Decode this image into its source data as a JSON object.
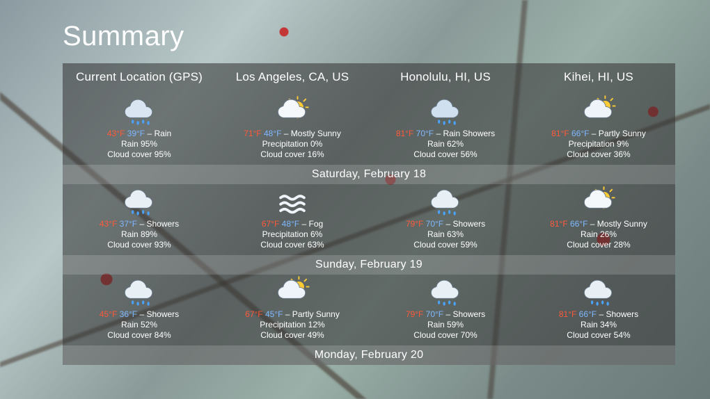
{
  "title": "Summary",
  "locations": [
    "Current Location (GPS)",
    "Los Angeles, CA, US",
    "Honolulu, HI, US",
    "Kihei, HI, US"
  ],
  "days": [
    {
      "label": "Saturday, February 18",
      "cells": [
        {
          "icon": "rain",
          "hi": "43°F",
          "lo": "39°F",
          "cond": "Rain",
          "precipLabel": "Rain 95%",
          "cloud": "Cloud cover 95%"
        },
        {
          "icon": "mostly-sunny",
          "hi": "71°F",
          "lo": "48°F",
          "cond": "Mostly Sunny",
          "precipLabel": "Precipitation 0%",
          "cloud": "Cloud cover 16%"
        },
        {
          "icon": "rain-showers",
          "hi": "81°F",
          "lo": "70°F",
          "cond": "Rain Showers",
          "precipLabel": "Rain 62%",
          "cloud": "Cloud cover 56%"
        },
        {
          "icon": "partly-sunny",
          "hi": "81°F",
          "lo": "66°F",
          "cond": "Partly Sunny",
          "precipLabel": "Precipitation 9%",
          "cloud": "Cloud cover 36%"
        }
      ]
    },
    {
      "label": "Sunday, February 19",
      "cells": [
        {
          "icon": "showers",
          "hi": "43°F",
          "lo": "37°F",
          "cond": "Showers",
          "precipLabel": "Rain 89%",
          "cloud": "Cloud cover 93%"
        },
        {
          "icon": "fog",
          "hi": "67°F",
          "lo": "48°F",
          "cond": "Fog",
          "precipLabel": "Precipitation 6%",
          "cloud": "Cloud cover 63%"
        },
        {
          "icon": "showers",
          "hi": "79°F",
          "lo": "70°F",
          "cond": "Showers",
          "precipLabel": "Rain 63%",
          "cloud": "Cloud cover 59%"
        },
        {
          "icon": "mostly-sunny",
          "hi": "81°F",
          "lo": "66°F",
          "cond": "Mostly Sunny",
          "precipLabel": "Rain 26%",
          "cloud": "Cloud cover 28%"
        }
      ]
    },
    {
      "label": "Monday, February 20",
      "cells": [
        {
          "icon": "showers",
          "hi": "45°F",
          "lo": "36°F",
          "cond": "Showers",
          "precipLabel": "Rain 52%",
          "cloud": "Cloud cover 84%"
        },
        {
          "icon": "partly-sunny",
          "hi": "67°F",
          "lo": "45°F",
          "cond": "Partly Sunny",
          "precipLabel": "Precipitation 12%",
          "cloud": "Cloud cover 49%"
        },
        {
          "icon": "showers",
          "hi": "79°F",
          "lo": "70°F",
          "cond": "Showers",
          "precipLabel": "Rain 59%",
          "cloud": "Cloud cover 70%"
        },
        {
          "icon": "showers",
          "hi": "81°F",
          "lo": "66°F",
          "cond": "Showers",
          "precipLabel": "Rain 34%",
          "cloud": "Cloud cover 54%"
        }
      ]
    }
  ]
}
